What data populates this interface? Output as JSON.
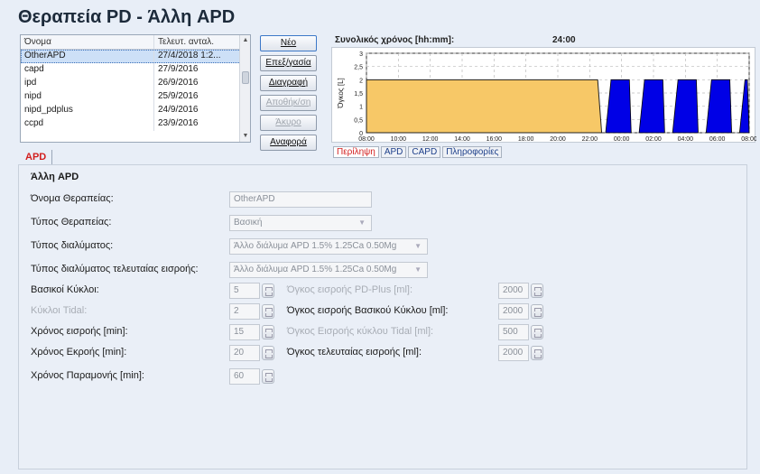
{
  "title": "Θεραπεία PD - Άλλη APD",
  "list": {
    "headers": [
      "Όνομα",
      "Τελευτ. ανταλ."
    ],
    "rows": [
      {
        "name": "OtherAPD",
        "date": "27/4/2018 1:2..."
      },
      {
        "name": "capd",
        "date": "27/9/2016"
      },
      {
        "name": "ipd",
        "date": "26/9/2016"
      },
      {
        "name": "nipd",
        "date": "25/9/2016"
      },
      {
        "name": "nipd_pdplus",
        "date": "24/9/2016"
      },
      {
        "name": "ccpd",
        "date": "23/9/2016"
      }
    ]
  },
  "buttons": {
    "new": "Νέο",
    "edit": "Επεξ/γασία",
    "delete": "Διαγραφή",
    "save": "Αποθήκ/ση",
    "cancel": "Άκυρο",
    "report": "Αναφορά"
  },
  "chart_header": {
    "label": "Συνολικός χρόνος [hh:mm]:",
    "value": "24:00"
  },
  "chart_data": {
    "type": "area",
    "ylabel": "Όγκος [L]",
    "xlabel": "",
    "yticks": [
      "0",
      "0,5",
      "1",
      "1,5",
      "2",
      "2,5",
      "3"
    ],
    "ylim": [
      0,
      3
    ],
    "xticks": [
      "08:00",
      "10:00",
      "12:00",
      "14:00",
      "16:00",
      "18:00",
      "20:00",
      "22:00",
      "00:00",
      "02:00",
      "04:00",
      "06:00",
      "08:00"
    ],
    "xlim_hours": [
      0,
      24
    ],
    "grid": true,
    "series": [
      {
        "color": "#f7c867",
        "points": [
          [
            0,
            2
          ],
          [
            14.5,
            2
          ],
          [
            14.75,
            0
          ]
        ]
      },
      {
        "color": "#0000e6",
        "cycles": [
          [
            15.0,
            16.6
          ],
          [
            17.1,
            18.7
          ],
          [
            19.2,
            20.8
          ],
          [
            21.3,
            22.9
          ],
          [
            23.4,
            24.0
          ]
        ],
        "volume": 2
      }
    ]
  },
  "chart_tabs": [
    "Περίληψη",
    "APD",
    "CAPD",
    "Πληροφορίες"
  ],
  "form_tab": "APD",
  "section_title": "Άλλη APD",
  "form": {
    "therapy_name_label": "Όνομα Θεραπείας:",
    "therapy_name_value": "OtherAPD",
    "therapy_type_label": "Τύπος Θεραπείας:",
    "therapy_type_value": "Βασική",
    "solution_type_label": "Τύπος διαλύματος:",
    "solution_type_value": "Άλλο διάλυμα APD 1.5% 1.25Ca 0.50Mg",
    "last_fill_solution_label": "Τύπος διαλύματος τελευταίας εισροής:",
    "last_fill_solution_value": "Άλλο διάλυμα APD 1.5% 1.25Ca 0.50Mg",
    "basic_cycles_label": "Βασικοί Κύκλοι:",
    "basic_cycles_value": "5",
    "tidal_cycles_label": "Κύκλοι Tidal:",
    "tidal_cycles_value": "2",
    "fill_time_label": "Χρόνος εισροής [min]:",
    "fill_time_value": "15",
    "drain_time_label": "Χρόνος Εκροής [min]:",
    "drain_time_value": "20",
    "dwell_time_label": "Χρόνος Παραμονής [min]:",
    "dwell_time_value": "60",
    "pdplus_volume_label": "Όγκος εισροής PD-Plus [ml]:",
    "pdplus_volume_value": "2000",
    "basic_cycle_volume_label": "Όγκος εισροής Βασικού Κύκλου [ml]:",
    "basic_cycle_volume_value": "2000",
    "tidal_volume_label": "Όγκος Εισροής κύκλου Tidal [ml]:",
    "tidal_volume_value": "500",
    "last_fill_volume_label": "Όγκος τελευταίας εισροής [ml]:",
    "last_fill_volume_value": "2000"
  }
}
